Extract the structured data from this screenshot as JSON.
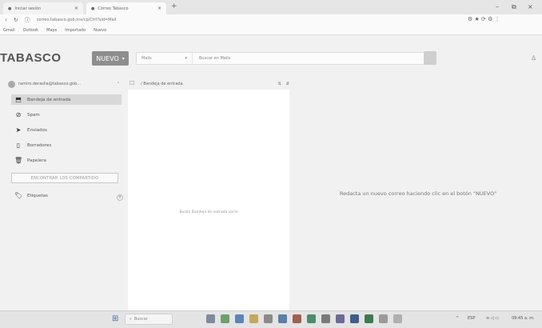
{
  "browser": {
    "tabs": [
      {
        "label": "Iniciar sesión",
        "active": false
      },
      {
        "label": "Correo Tabasco",
        "active": true
      }
    ],
    "new_tab": "+",
    "url": "correo.tabasco.gob.mx/cp/Ctrl?sid=Mail",
    "bookmarks": [
      "Gmail",
      "Outlook",
      "Maps",
      "Importado",
      "Nuevo"
    ],
    "window_controls": [
      "–",
      "⧉",
      "×"
    ]
  },
  "app": {
    "logo": "TABASCO",
    "new_button": "NUEVO",
    "new_button_caret": "▾",
    "search_scope": "Mails",
    "search_placeholder": "Buscar en Mails",
    "user_email": "ramiro.deraslia@tabasco.gob...",
    "sidebar": {
      "items": [
        {
          "label": "Bandeja de entrada",
          "icon": "inbox-icon",
          "glyph": "⬒",
          "active": true
        },
        {
          "label": "Spam",
          "icon": "spam-icon",
          "glyph": "⊘",
          "active": false
        },
        {
          "label": "Enviados",
          "icon": "send-icon",
          "glyph": "➤",
          "active": false
        },
        {
          "label": "Borradores",
          "icon": "draft-icon",
          "glyph": "▯",
          "active": false
        },
        {
          "label": "Papelera",
          "icon": "trash-icon",
          "glyph": "🗑",
          "active": false
        }
      ],
      "shared_button": "ENCONTRAR LOS COMPARTIDO",
      "tags_label": "Etiquetas",
      "tags_add": "+"
    },
    "list": {
      "breadcrumb": "/ Bandeja de entrada",
      "empty_message": "Buzón Bandeja de entrada vacío"
    },
    "reading_pane": {
      "message": "Redacta un nuevo correo haciendo clic en el botón \"NUEVO\""
    }
  },
  "taskbar": {
    "search_placeholder": "Buscar",
    "clock": "09:45 a. m.",
    "lang": "ESP"
  }
}
